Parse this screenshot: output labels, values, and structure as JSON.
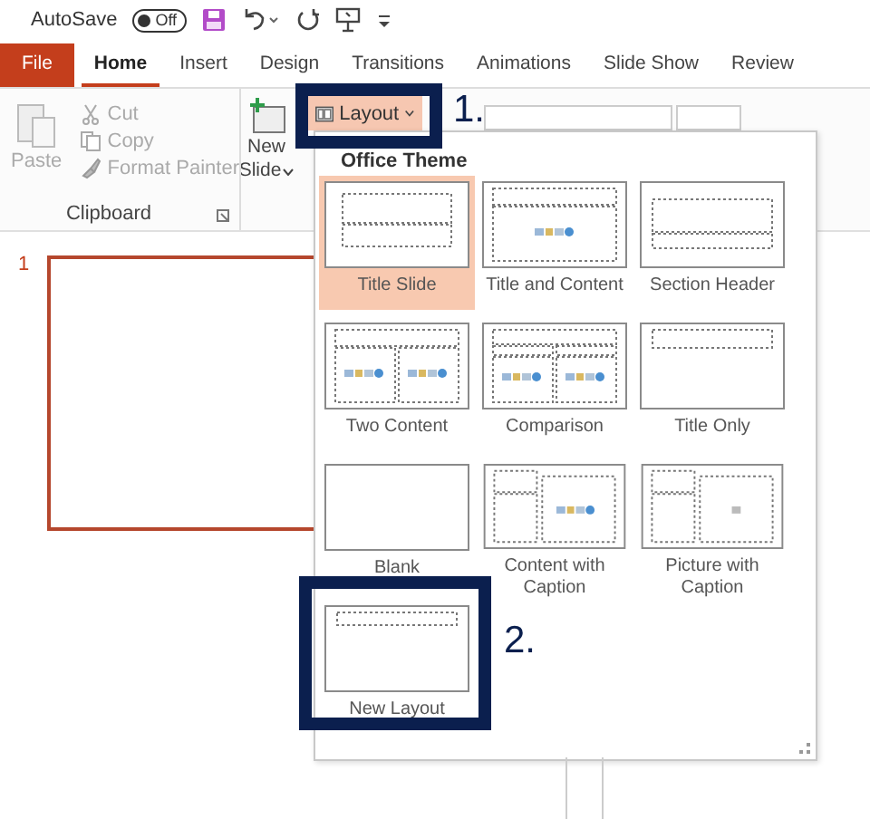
{
  "quick_access": {
    "autosave_label": "AutoSave",
    "autosave_toggle": {
      "label": "Off",
      "on": false
    }
  },
  "tabs": [
    {
      "label": "File",
      "kind": "file",
      "selected": false
    },
    {
      "label": "Home",
      "kind": "tab",
      "selected": true
    },
    {
      "label": "Insert",
      "kind": "tab",
      "selected": false
    },
    {
      "label": "Design",
      "kind": "tab",
      "selected": false
    },
    {
      "label": "Transitions",
      "kind": "tab",
      "selected": false
    },
    {
      "label": "Animations",
      "kind": "tab",
      "selected": false
    },
    {
      "label": "Slide Show",
      "kind": "tab",
      "selected": false
    },
    {
      "label": "Review",
      "kind": "tab",
      "selected": false
    }
  ],
  "clipboard": {
    "paste": {
      "label": "Paste",
      "disabled": true
    },
    "items": [
      {
        "label": "Cut",
        "kind": "cut",
        "disabled": true
      },
      {
        "label": "Copy",
        "kind": "copy",
        "disabled": true
      },
      {
        "label": "Format Painter",
        "kind": "painter",
        "disabled": true
      }
    ],
    "group_label": "Clipboard"
  },
  "new_slide": {
    "line1": "New",
    "line2": "Slide"
  },
  "layout_button": {
    "label": "Layout",
    "expanded": true
  },
  "gallery": {
    "header": "Office Theme",
    "layouts": [
      {
        "label": "Title Slide",
        "kind": "title",
        "selected": true
      },
      {
        "label": "Title and Content",
        "kind": "title-content",
        "selected": false
      },
      {
        "label": "Section Header",
        "kind": "section",
        "selected": false
      },
      {
        "label": "Two Content",
        "kind": "two-content",
        "selected": false
      },
      {
        "label": "Comparison",
        "kind": "comparison",
        "selected": false
      },
      {
        "label": "Title Only",
        "kind": "title-only",
        "selected": false
      },
      {
        "label": "Blank",
        "kind": "blank",
        "selected": false
      },
      {
        "label": "Content with Caption",
        "kind": "content-caption",
        "selected": false
      },
      {
        "label": "Picture with Caption",
        "kind": "picture-caption",
        "selected": false
      },
      {
        "label": "New Layout",
        "kind": "title-only-small",
        "selected": false
      }
    ]
  },
  "annotations": [
    "1.",
    "2."
  ],
  "slide_panel": {
    "number": "1"
  }
}
